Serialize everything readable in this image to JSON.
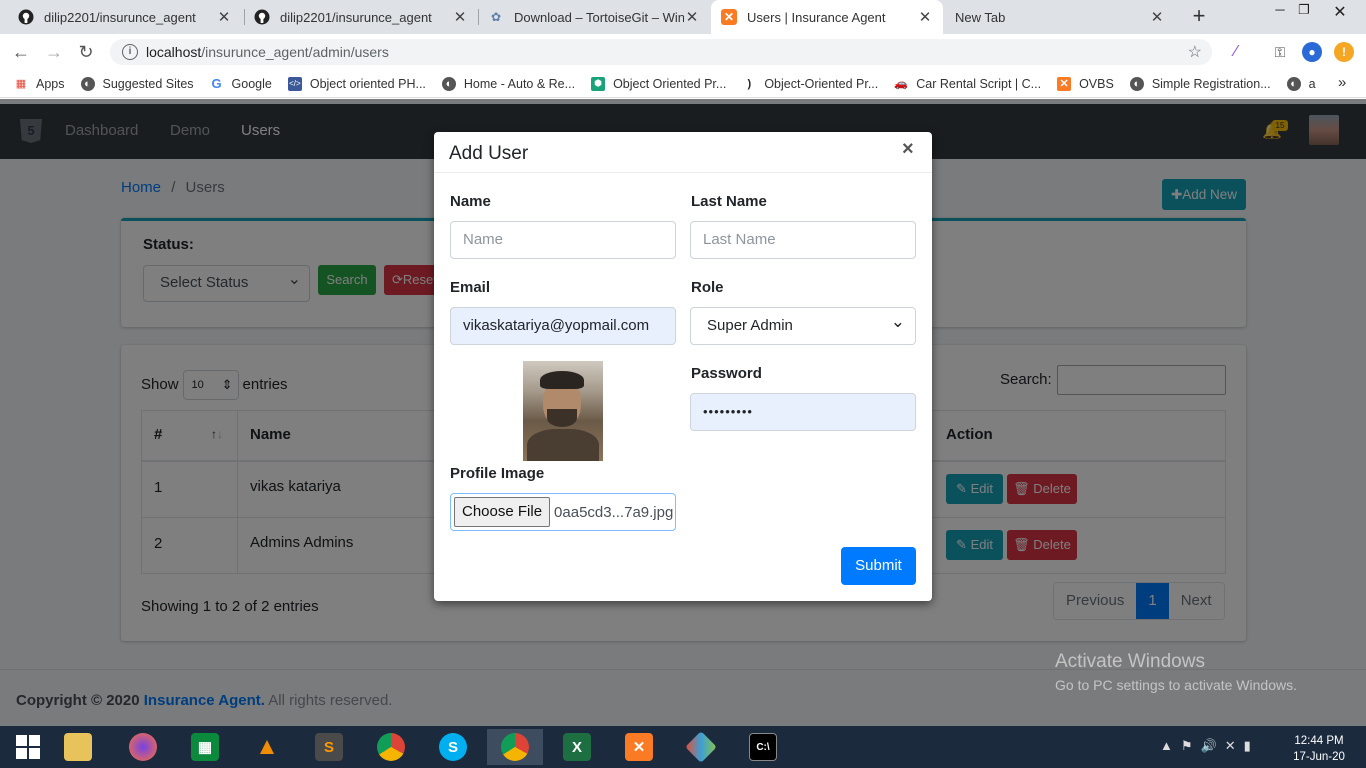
{
  "browser": {
    "tabs": [
      {
        "title": "dilip2201/insurunce_agent",
        "icon": "github-icon",
        "active": false
      },
      {
        "title": "dilip2201/insurunce_agent",
        "icon": "github-icon",
        "active": false
      },
      {
        "title": "Download – TortoiseGit – Windo",
        "icon": "tortoisegit-icon",
        "active": false
      },
      {
        "title": "Users | Insurance Agent",
        "icon": "xampp-icon",
        "active": true
      },
      {
        "title": "New Tab",
        "icon": "",
        "active": false
      }
    ],
    "url_host": "localhost",
    "url_path": "/insurunce_agent/admin/users",
    "bookmarks": [
      {
        "label": "Apps",
        "icon": "apps-grid-icon",
        "color": "#e94235"
      },
      {
        "label": "Suggested Sites",
        "icon": "globe-icon",
        "color": "#555555"
      },
      {
        "label": "Google",
        "icon": "google-icon",
        "color": "#4285f4"
      },
      {
        "label": "Object oriented PH...",
        "icon": "php-icon",
        "color": "#3b5998"
      },
      {
        "label": "Home - Auto & Re...",
        "icon": "globe-icon",
        "color": "#555555"
      },
      {
        "label": "Object Oriented Pr...",
        "icon": "shield-icon",
        "color": "#1aa37a"
      },
      {
        "label": "Object-Oriented Pr...",
        "icon": "bracket-icon",
        "color": "#222222"
      },
      {
        "label": "Car Rental Script | C...",
        "icon": "car-icon",
        "color": "#e8a33d"
      },
      {
        "label": "OVBS",
        "icon": "xampp-icon",
        "color": "#fb7a24"
      },
      {
        "label": "Simple Registration...",
        "icon": "globe-icon",
        "color": "#555555"
      },
      {
        "label": "a",
        "icon": "globe-icon",
        "color": "#555555"
      }
    ],
    "more_bookmarks": "»"
  },
  "app": {
    "nav": [
      "Dashboard",
      "Demo",
      "Users"
    ],
    "active_nav": "Users",
    "notification_count": "15",
    "breadcrumb_home": "Home",
    "breadcrumb_sep": "/",
    "breadcrumb_current": "Users",
    "add_new_label": "Add New",
    "status_label": "Status:",
    "status_select": "Select Status",
    "search_button": "Search",
    "reset_button": "Reset",
    "show_label": "Show",
    "entries_value": "10",
    "entries_label": "entries",
    "search_label": "Search:",
    "table": {
      "headers": [
        "#",
        "Name",
        "Action"
      ],
      "rows": [
        {
          "num": "1",
          "name": "vikas katariya"
        },
        {
          "num": "2",
          "name": "Admins Admins"
        }
      ],
      "edit_label": "Edit",
      "delete_label": "Delete"
    },
    "showing_text": "Showing 1 to 2 of 2 entries",
    "pager": [
      "Previous",
      "1",
      "Next"
    ],
    "footer_copyright": "Copyright © 2020",
    "footer_brand": "Insurance Agent.",
    "footer_rights": "All rights reserved."
  },
  "modal": {
    "title": "Add User",
    "close": "×",
    "name_label": "Name",
    "name_placeholder": "Name",
    "lastname_label": "Last Name",
    "lastname_placeholder": "Last Name",
    "email_label": "Email",
    "email_value": "vikaskatariya@yopmail.com",
    "role_label": "Role",
    "role_value": "Super Admin",
    "password_label": "Password",
    "password_value": "•••••••••",
    "profile_label": "Profile Image",
    "choose_file": "Choose File",
    "file_name": "0aa5cd3...7a9.jpg",
    "submit": "Submit"
  },
  "watermark": {
    "line1": "Activate Windows",
    "line2": "Go to PC settings to activate Windows."
  },
  "taskbar": {
    "time": "12:44 PM",
    "date": "17-Jun-20"
  },
  "colors": {
    "primary": "#007bff",
    "info": "#17a2b8",
    "success": "#28a745",
    "danger": "#dc3545",
    "navbar": "#343a40"
  }
}
